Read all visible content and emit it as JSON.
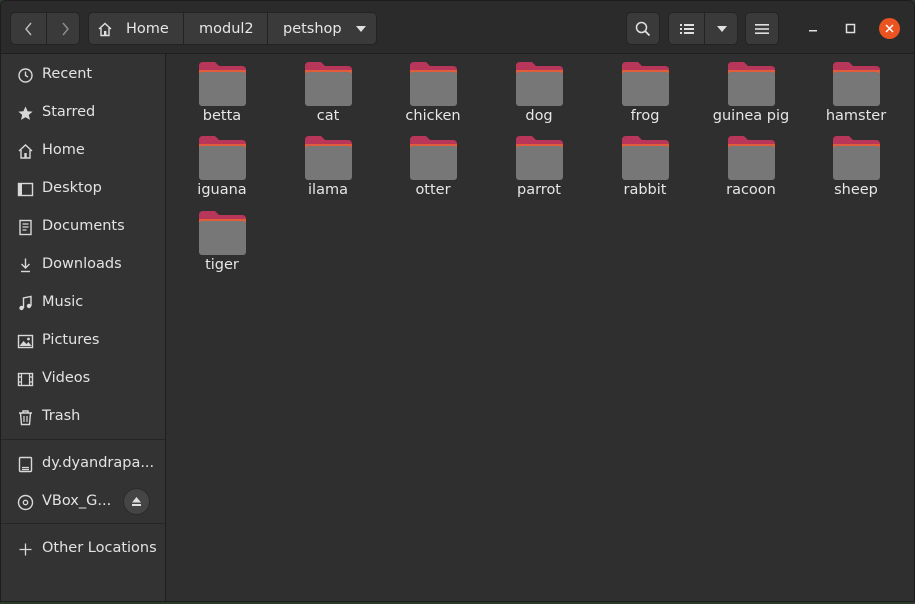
{
  "pathbar": {
    "crumbs": [
      {
        "label": "Home"
      },
      {
        "label": "modul2"
      },
      {
        "label": "petshop"
      }
    ]
  },
  "sidebar": {
    "items": [
      {
        "label": "Recent",
        "icon": "clock-icon"
      },
      {
        "label": "Starred",
        "icon": "star-icon"
      },
      {
        "label": "Home",
        "icon": "home-icon"
      },
      {
        "label": "Desktop",
        "icon": "desktop-icon"
      },
      {
        "label": "Documents",
        "icon": "document-icon"
      },
      {
        "label": "Downloads",
        "icon": "download-icon"
      },
      {
        "label": "Music",
        "icon": "music-icon"
      },
      {
        "label": "Pictures",
        "icon": "picture-icon"
      },
      {
        "label": "Videos",
        "icon": "video-icon"
      },
      {
        "label": "Trash",
        "icon": "trash-icon"
      }
    ],
    "devices": [
      {
        "label": "dy.dyandrapa...",
        "icon": "drive-icon"
      },
      {
        "label": "VBox_G...",
        "icon": "disc-icon"
      }
    ],
    "other_locations": "Other Locations"
  },
  "files": [
    {
      "name": "betta"
    },
    {
      "name": "cat"
    },
    {
      "name": "chicken"
    },
    {
      "name": "dog"
    },
    {
      "name": "frog"
    },
    {
      "name": "guinea pig"
    },
    {
      "name": "hamster"
    },
    {
      "name": "iguana"
    },
    {
      "name": "ilama"
    },
    {
      "name": "otter"
    },
    {
      "name": "parrot"
    },
    {
      "name": "rabbit"
    },
    {
      "name": "racoon"
    },
    {
      "name": "sheep"
    },
    {
      "name": "tiger"
    }
  ],
  "colors": {
    "accent": "#e95420",
    "folder_tab": "#c0395a",
    "folder_body": "#7a7a7a"
  }
}
